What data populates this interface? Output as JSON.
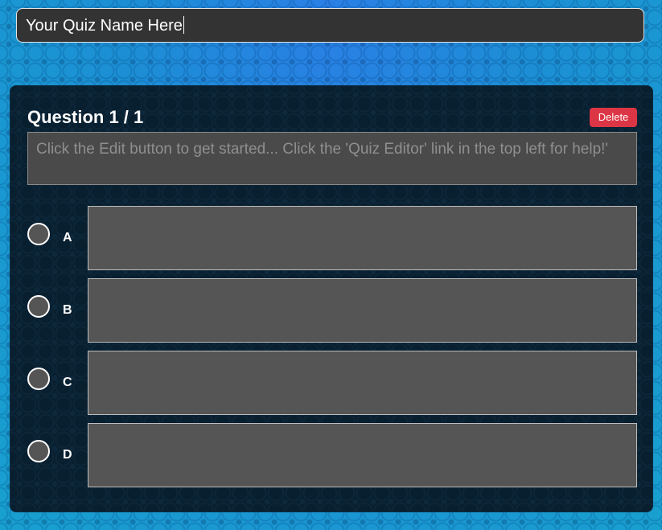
{
  "quiz": {
    "name": "Your Quiz Name Here"
  },
  "question": {
    "heading": "Question 1 / 1",
    "delete_label": "Delete",
    "text_placeholder": "Click the Edit button to get started... Click the 'Quiz Editor' link in the top left for help!'"
  },
  "answers": [
    {
      "letter": "A",
      "value": ""
    },
    {
      "letter": "B",
      "value": ""
    },
    {
      "letter": "C",
      "value": ""
    },
    {
      "letter": "D",
      "value": ""
    }
  ],
  "colors": {
    "accent_delete": "#dc3545",
    "card_background": "#081f30",
    "field_background": "#555555"
  }
}
